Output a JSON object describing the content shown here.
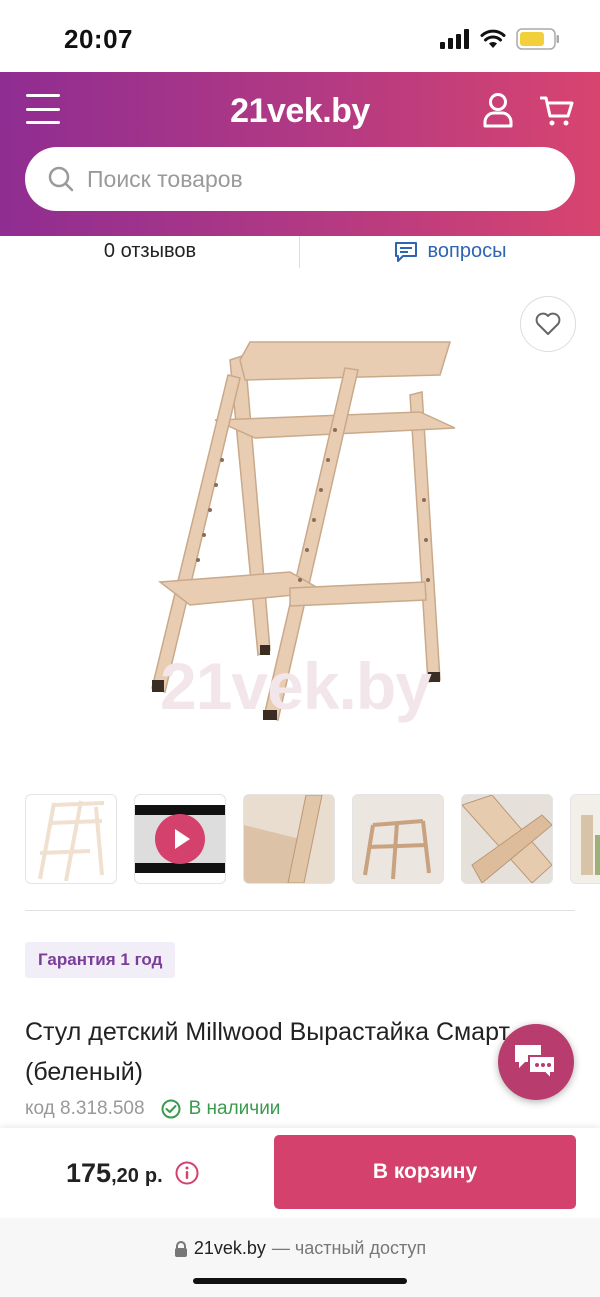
{
  "status": {
    "time": "20:07"
  },
  "header": {
    "logo": "21vek.by"
  },
  "search": {
    "placeholder": "Поиск товаров"
  },
  "tabs": {
    "reviews_label": "0 отзывов",
    "questions_label": "вопросы"
  },
  "product": {
    "watermark": "21vek.by",
    "guarantee": "Гарантия 1 год",
    "title": "Стул детский Millwood Вырастайка Смарт (беленый)",
    "code": "код 8.318.508",
    "stock": "В наличии",
    "thumbnails": [
      "photo-1",
      "video",
      "photo-3",
      "photo-4",
      "photo-5",
      "photo-6"
    ]
  },
  "price": {
    "main": "175",
    "fraction": ",20",
    "currency": "р."
  },
  "buttons": {
    "add_to_cart": "В корзину"
  },
  "browser": {
    "domain": "21vek.by",
    "suffix": "— частный доступ"
  },
  "colors": {
    "accent": "#d4416c",
    "header_start": "#8f2d92",
    "header_end": "#d84470",
    "stock_green": "#3a9a4e",
    "link_blue": "#2d64b3"
  }
}
